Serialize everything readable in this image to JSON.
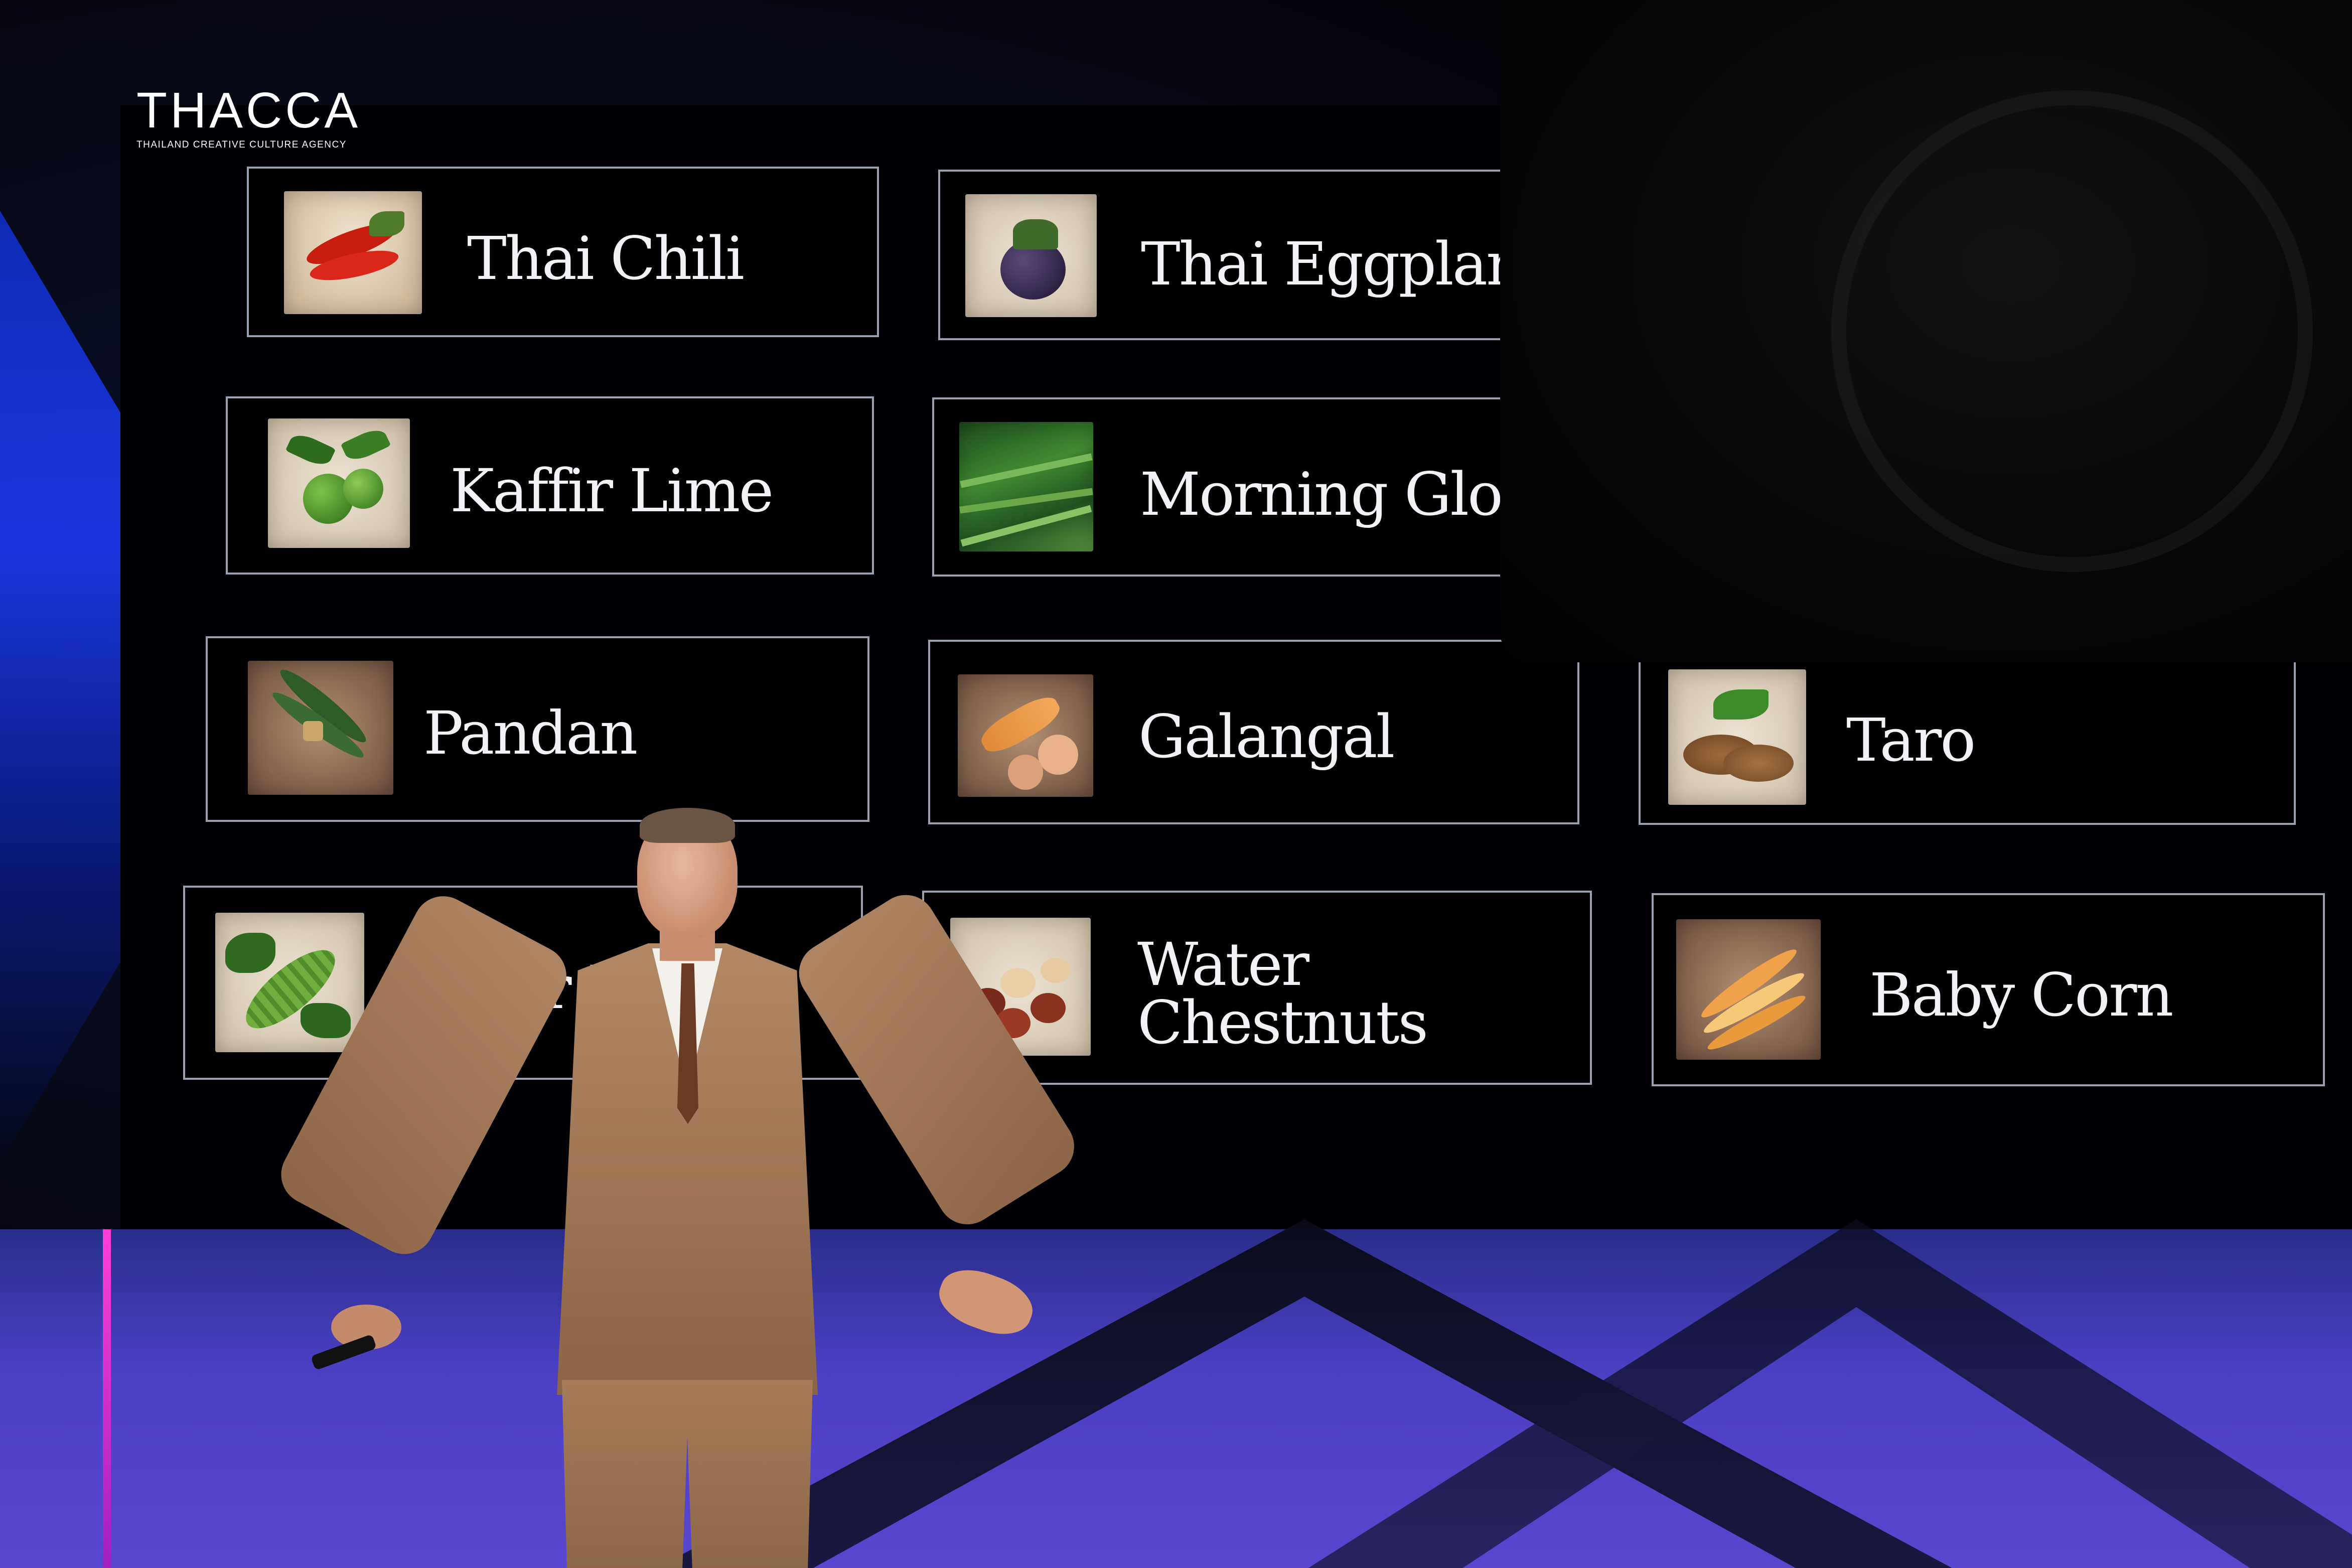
{
  "logo": {
    "wordmark": "THACCA",
    "tagline": "THAILAND CREATIVE CULTURE AGENCY"
  },
  "slide": {
    "cards": [
      {
        "label": "Thai Chili",
        "icon": "chili-peppers-image"
      },
      {
        "label": "Thai Eggplant",
        "icon": "eggplant-image"
      },
      {
        "label": "Kaffir Lime",
        "icon": "kaffir-lime-image"
      },
      {
        "label": "Morning Glory",
        "icon": "morning-glory-image"
      },
      {
        "label": "Pandan",
        "icon": "pandan-leaves-image"
      },
      {
        "label": "Galangal",
        "icon": "galangal-root-image"
      },
      {
        "label": "Taro",
        "icon": "taro-root-image"
      },
      {
        "label": "Bitter Melon",
        "icon": "bitter-melon-image"
      },
      {
        "label": "Water Chestnuts",
        "icon": "water-chestnuts-image"
      },
      {
        "label": "Baby Corn",
        "icon": "baby-corn-image"
      }
    ],
    "card_labels_two_line": {
      "water_chestnuts_line1": "Water",
      "water_chestnuts_line2": "Chestnuts"
    }
  },
  "colors": {
    "screen_background": "#000004",
    "card_border": "#9aa0b0",
    "label_text": "#f2f2f6",
    "stage_blue": "#1c3cff",
    "stage_purple": "#5a46cf"
  }
}
